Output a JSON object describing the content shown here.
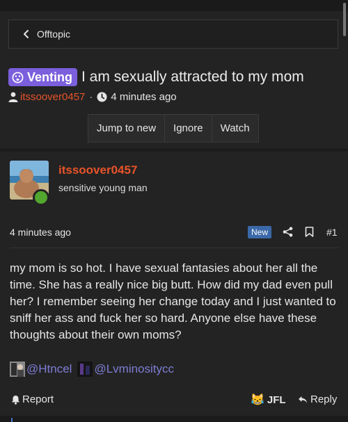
{
  "breadcrumb": {
    "label": "Offtopic"
  },
  "thread": {
    "prefix": "Venting",
    "title": "I am sexually attracted to my mom",
    "author": "itssoover0457",
    "separator": "·",
    "time": "4 minutes ago"
  },
  "actions": {
    "jump": "Jump to new",
    "ignore": "Ignore",
    "watch": "Watch"
  },
  "post": {
    "author": "itssoover0457",
    "user_title": "sensitive young man",
    "time": "4 minutes ago",
    "new_label": "New",
    "number": "#1",
    "body": "my mom is so hot. I have sexual fantasies about her all the time. She has a really nice big butt. How did my dad even pull her? I remember seeing her change today and I just wanted to sniff her ass and fuck her so hard. Anyone else have these thoughts about their own moms?",
    "mentions": [
      "@Htncel",
      "@Lvminositycc"
    ]
  },
  "footer": {
    "report_label": "Report",
    "reaction_emoji": "😹",
    "reaction_label": "JFL",
    "reply_label": "Reply"
  },
  "colors": {
    "background": "#232323",
    "accent_orange": "#e8542a",
    "badge_purple": "#7b5fdc",
    "mention_blue": "#7d7dd6",
    "new_badge_blue": "#3a68a8",
    "online_green": "#52a82e"
  },
  "icons": [
    "chevron-left-icon",
    "venting-face-icon",
    "user-icon",
    "clock-icon",
    "share-icon",
    "bookmark-icon",
    "bell-icon",
    "reply-icon"
  ]
}
